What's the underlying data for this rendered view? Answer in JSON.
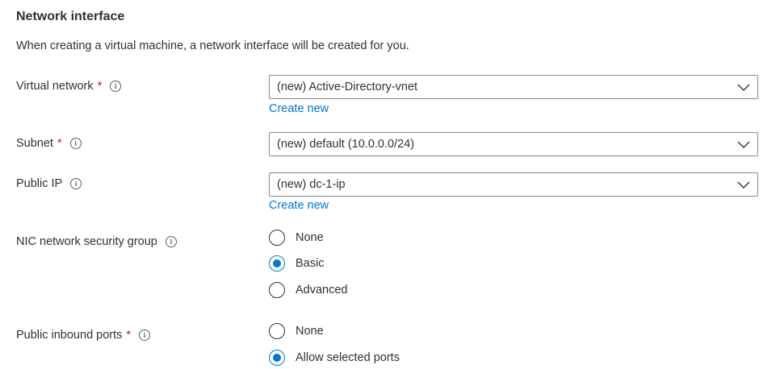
{
  "section": {
    "title": "Network interface",
    "description": "When creating a virtual machine, a network interface will be created for you."
  },
  "fields": {
    "virtual_network": {
      "label": "Virtual network",
      "required_mark": "*",
      "info_icon": "i",
      "value": "(new) Active-Directory-vnet",
      "create_new": "Create new"
    },
    "subnet": {
      "label": "Subnet",
      "required_mark": "*",
      "info_icon": "i",
      "value": "(new) default (10.0.0.0/24)"
    },
    "public_ip": {
      "label": "Public IP",
      "info_icon": "i",
      "value": "(new) dc-1-ip",
      "create_new": "Create new"
    },
    "nic_nsg": {
      "label": "NIC network security group",
      "info_icon": "i",
      "options": [
        "None",
        "Basic",
        "Advanced"
      ],
      "selected": "Basic"
    },
    "public_inbound_ports": {
      "label": "Public inbound ports",
      "required_mark": "*",
      "info_icon": "i",
      "options": [
        "None",
        "Allow selected ports"
      ],
      "selected": "Allow selected ports"
    }
  },
  "colors": {
    "accent": "#0078d4",
    "required": "#a4262c",
    "text": "#323130"
  },
  "icons": {
    "info": "info-icon",
    "dropdown": "chevron-down-icon"
  }
}
